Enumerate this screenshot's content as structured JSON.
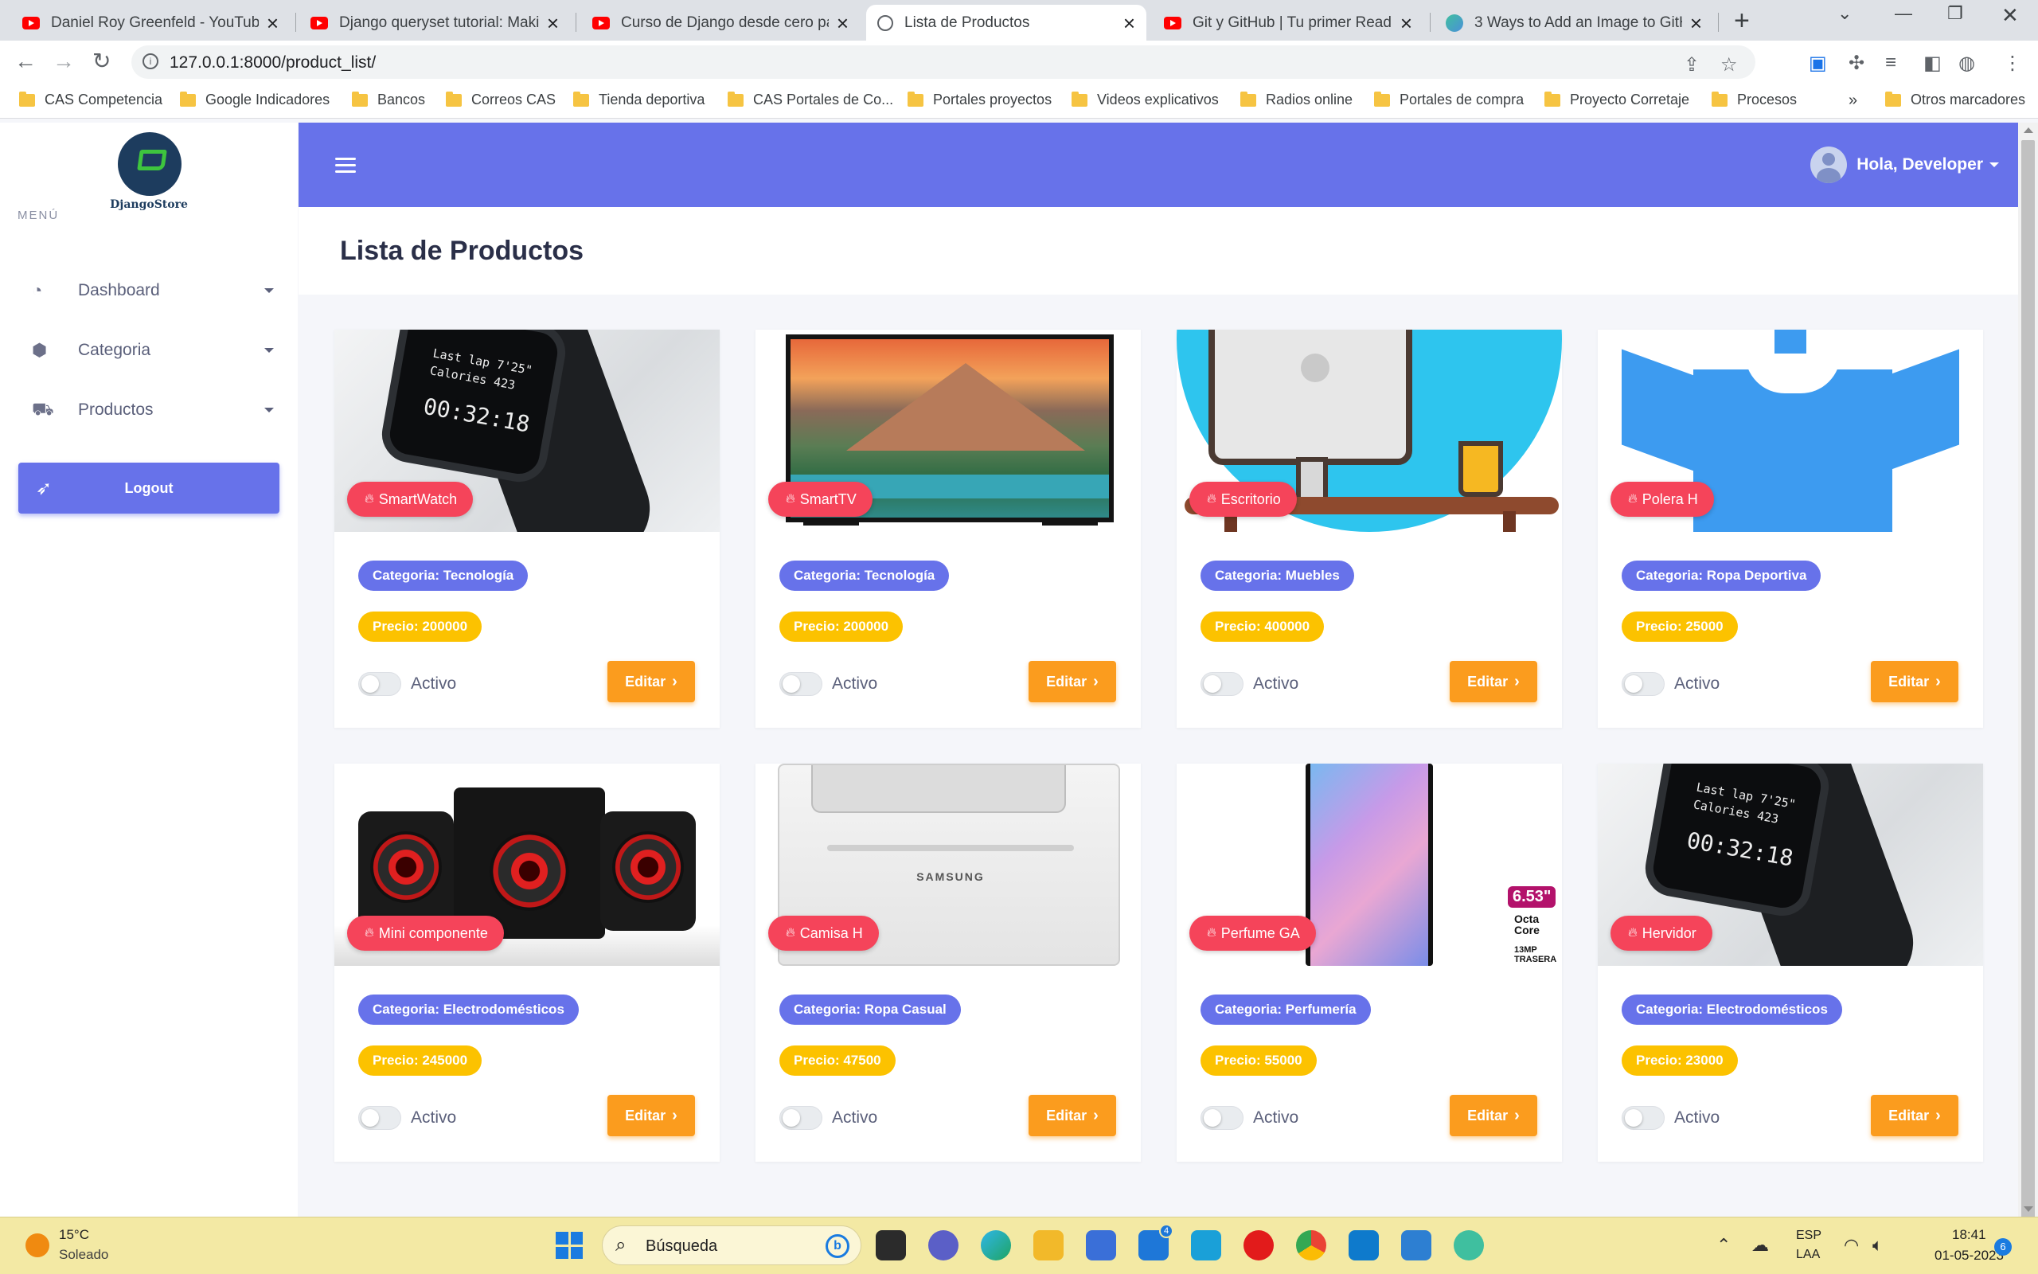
{
  "browser": {
    "tabs": [
      {
        "title": "Daniel Roy Greenfeld - YouTube"
      },
      {
        "title": "Django queryset tutorial: Making"
      },
      {
        "title": "Curso de Django desde cero para"
      },
      {
        "title": "Lista de Productos"
      },
      {
        "title": "Git y GitHub | Tu primer Readme"
      },
      {
        "title": "3 Ways to Add an Image to GitHub"
      }
    ],
    "url": "127.0.0.1:8000/product_list/",
    "bookmarks": [
      "CAS Competencia",
      "Google Indicadores",
      "Bancos",
      "Correos CAS",
      "Tienda deportiva",
      "CAS Portales de Co...",
      "Portales proyectos",
      "Videos explicativos",
      "Radios online",
      "Portales de compra",
      "Proyecto Corretaje",
      "Procesos"
    ],
    "bookmarks_overflow": "»",
    "other_bookmarks": "Otros marcadores"
  },
  "sidebar": {
    "brand": "DjangoStore",
    "menu_heading": "MENÚ",
    "items": [
      {
        "label": "Dashboard",
        "icon": "gauge-icon"
      },
      {
        "label": "Categoria",
        "icon": "cube-icon"
      },
      {
        "label": "Productos",
        "icon": "truck-icon"
      }
    ],
    "logout": "Logout"
  },
  "topnav": {
    "greeting": "Hola, Developer"
  },
  "page": {
    "title": "Lista de Productos"
  },
  "product_labels": {
    "status": "Activo",
    "edit": "Editar"
  },
  "products": [
    {
      "name": "SmartWatch",
      "category": "Categoria: Tecnología",
      "price": "Precio: 200000"
    },
    {
      "name": "SmartTV",
      "category": "Categoria: Tecnología",
      "price": "Precio: 200000"
    },
    {
      "name": "Escritorio",
      "category": "Categoria: Muebles",
      "price": "Precio: 400000"
    },
    {
      "name": "Polera H",
      "category": "Categoria: Ropa Deportiva",
      "price": "Precio: 25000"
    },
    {
      "name": "Mini componente",
      "category": "Categoria: Electrodomésticos",
      "price": "Precio: 245000"
    },
    {
      "name": "Camisa H",
      "category": "Categoria: Ropa Casual",
      "price": "Precio: 47500"
    },
    {
      "name": "Perfume GA",
      "category": "Categoria: Perfumería",
      "price": "Precio: 55000"
    },
    {
      "name": "Hervidor",
      "category": "Categoria: Electrodomésticos",
      "price": "Precio: 23000"
    }
  ],
  "image_text": {
    "watch_line1": "Last lap 7'25\"",
    "watch_line2": "Calories 423",
    "watch_time": "00:32:18",
    "printer_brand": "SAMSUNG",
    "phone_size": "6.53\"",
    "phone_core": "Octa Core",
    "phone_camera": "13MP TRASERA"
  },
  "taskbar": {
    "temperature": "15°C",
    "weather": "Soleado",
    "search": "Búsqueda",
    "lang1": "ESP",
    "lang2": "LAA",
    "time": "18:41",
    "date": "01-05-2023",
    "notifications": "6",
    "mail_badge": "4"
  },
  "colors": {
    "primary": "#6772ea",
    "name_badge": "#f5445a",
    "price_badge": "#fcc200",
    "edit_button": "#fb9c1e"
  }
}
